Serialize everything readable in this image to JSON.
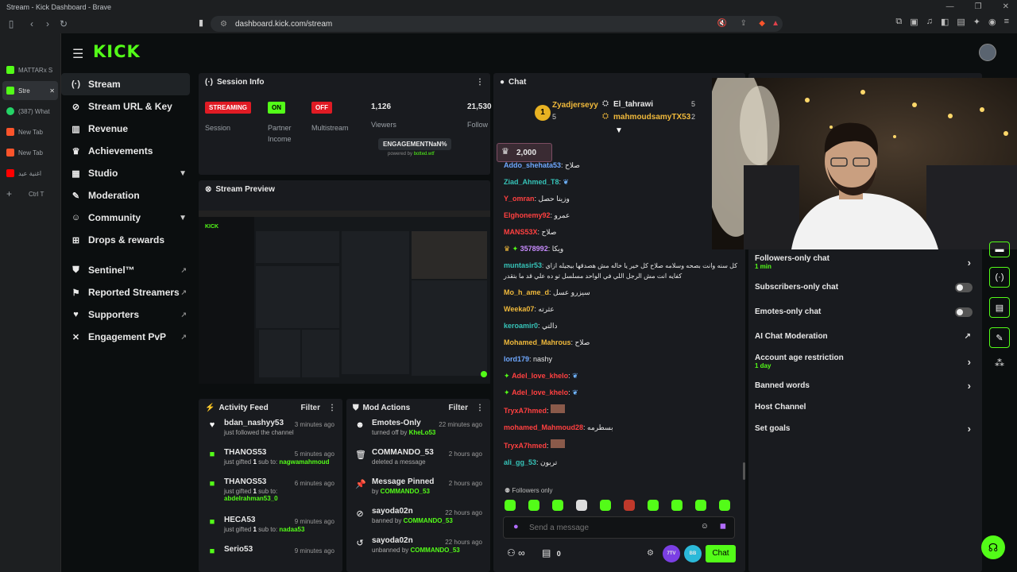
{
  "browser": {
    "window_title": "Stream - Kick Dashboard - Brave",
    "url": "dashboard.kick.com/stream",
    "tabs": [
      {
        "label": "MATTARx S",
        "color": "#53fc18"
      },
      {
        "label": "Stre",
        "color": "#53fc18",
        "active": true
      },
      {
        "label": "(387) What",
        "color": "#25d366"
      },
      {
        "label": "New Tab",
        "color": "#fb542b"
      },
      {
        "label": "New Tab",
        "color": "#fb542b"
      },
      {
        "label": "اغنية عيد ",
        "color": "#ff0000"
      }
    ],
    "new_tab_hint": "Ctrl T"
  },
  "brand": {
    "logo": "KICK",
    "accent": "#53fc18"
  },
  "sidebar": {
    "items": [
      {
        "label": "Stream",
        "icon": "broadcast-icon"
      },
      {
        "label": "Stream URL & Key",
        "icon": "link-icon"
      },
      {
        "label": "Revenue",
        "icon": "chart-icon"
      },
      {
        "label": "Achievements",
        "icon": "trophy-icon"
      },
      {
        "label": "Studio",
        "icon": "studio-icon"
      },
      {
        "label": "Moderation",
        "icon": "wrench-icon"
      },
      {
        "label": "Community",
        "icon": "people-icon"
      },
      {
        "label": "Drops & rewards",
        "icon": "drops-icon"
      },
      {
        "label": "Sentinel™",
        "icon": "shield-icon"
      },
      {
        "label": "Reported Streamers",
        "icon": "flag-icon"
      },
      {
        "label": "Supporters",
        "icon": "heart-icon"
      },
      {
        "label": "Engagement PvP",
        "icon": "swords-icon"
      }
    ]
  },
  "session": {
    "title": "Session Info",
    "streaming_tag": "STREAMING",
    "streaming_label": "Session",
    "partner_tag": "ON",
    "partner_label_1": "Partner",
    "partner_label_2": "Income",
    "multistream_tag": "OFF",
    "multistream_label": "Multistream",
    "viewers_value": "1,126",
    "viewers_label": "Viewers",
    "followers_value": "21,530",
    "followers_label": "Follow",
    "engagement": "ENGAGEMENTNaN%",
    "powered_by": "powered by",
    "powered_by_link": "botted.wtf"
  },
  "preview": {
    "title": "Stream Preview"
  },
  "activity": {
    "title": "Activity Feed",
    "filter": "Filter",
    "items": [
      {
        "user": "bdan_nashyy53",
        "detail": "just followed the channel",
        "ago": "3 minutes ago",
        "icon": "heart-icon"
      },
      {
        "user": "THANOS53",
        "detail_prefix": "just gifted ",
        "count": "1",
        "detail_mid": " sub to: ",
        "target": "nagwamahmoud",
        "ago": "5 minutes ago",
        "icon": "gift-icon"
      },
      {
        "user": "THANOS53",
        "detail_prefix": "just gifted ",
        "count": "1",
        "detail_mid": " sub to:",
        "target": "abdelrahman53_0",
        "ago": "6 minutes ago",
        "icon": "gift-icon"
      },
      {
        "user": "HECA53",
        "detail_prefix": "just gifted ",
        "count": "1",
        "detail_mid": " sub to: ",
        "target": "nadaa53",
        "ago": "9 minutes ago",
        "icon": "gift-icon"
      },
      {
        "user": "Serio53",
        "ago": "9 minutes ago",
        "icon": "gift-icon"
      }
    ]
  },
  "mod": {
    "title": "Mod Actions",
    "filter": "Filter",
    "items": [
      {
        "title": "Emotes-Only",
        "detail": "turned off by ",
        "by": "KheLo53",
        "ago": "22 minutes ago",
        "icon": "smile-icon"
      },
      {
        "title": "COMMANDO_53",
        "detail": "deleted a message",
        "by": "",
        "ago": "2 hours ago",
        "icon": "trash-icon"
      },
      {
        "title": "Message Pinned",
        "detail": "by ",
        "by": "COMMANDO_53",
        "ago": "2 hours ago",
        "icon": "pin-icon"
      },
      {
        "title": "sayoda02n",
        "detail": "banned by ",
        "by": "COMMANDO_53",
        "ago": "22 hours ago",
        "icon": "ban-icon"
      },
      {
        "title": "sayoda02n",
        "detail": "unbanned by ",
        "by": "COMMANDO_53",
        "ago": "22 hours ago",
        "icon": "undo-icon"
      }
    ]
  },
  "chat": {
    "title": "Chat",
    "top_gifters": [
      {
        "name": "Zyadjerseyy",
        "count": "5"
      },
      {
        "name": "El_tahrawi",
        "count": "5"
      },
      {
        "name": "mahmoudsamyTX53",
        "count": "2"
      }
    ],
    "rank_badge": "1",
    "pinned_value": "2,000",
    "messages": [
      {
        "user": "Addo_shehata53",
        "text": "صلاح",
        "cls": "u-b"
      },
      {
        "user": "Ziad_Ahmed_T8",
        "text": "",
        "cls": "u-g",
        "emote": true
      },
      {
        "user": "Y_omran",
        "text": "وزينا حصل",
        "cls": "u-r"
      },
      {
        "user": "Elghonemy92",
        "text": "عمرو",
        "cls": "u-r"
      },
      {
        "user": "MANS53X",
        "text": "صلاح",
        "cls": "u-r"
      },
      {
        "user": "3578992",
        "text": "ويكا",
        "cls": "u-p"
      },
      {
        "user": "muntasir53",
        "text": "كل سنه وانت بصحه وسلامه صلاح كل خير يا خاله مش هصدقها بيجيله ازاي",
        "cls": "u-g"
      },
      {
        "user": "",
        "text": "كفايه انت مش الرجل اللي في الواحد مسلسل تو ده علي قد ما بتقدر",
        "cls": "u-g"
      },
      {
        "user": "Mo_h_ame_d",
        "text": "سيزرو عسل",
        "cls": "u-o"
      },
      {
        "user": "Weeka07",
        "text": "عثرته",
        "cls": "u-o"
      },
      {
        "user": "keroamir0",
        "text": "دالتي",
        "cls": "u-g"
      },
      {
        "user": "Mohamed_Mahrous",
        "text": "صلاح",
        "cls": "u-o"
      },
      {
        "user": "lord179",
        "text": "nashy",
        "cls": "u-b"
      },
      {
        "user": "Adel_love_khelo",
        "text": "",
        "cls": "u-r",
        "emote": true
      },
      {
        "user": "Adel_love_khelo",
        "text": "",
        "cls": "u-r",
        "emote": true
      },
      {
        "user": "TryxA7hmed",
        "text": "",
        "cls": "u-r",
        "img": true
      },
      {
        "user": "mohamed_Mahmoud28",
        "text": "بسطرمه",
        "cls": "u-r"
      },
      {
        "user": "TryxA7hmed",
        "text": "",
        "cls": "u-r",
        "img": true
      },
      {
        "user": "ali_gg_53",
        "text": "تربون",
        "cls": "u-g"
      }
    ],
    "mode": "Followers only",
    "input_placeholder": "Send a message",
    "infinity": "∞",
    "count": "0",
    "badge_7tv": "7TV",
    "badge_bttv": "BB",
    "send_label": "Chat"
  },
  "settings": {
    "items": [
      {
        "label": "Followers-only chat",
        "sub": "1 min",
        "control": "chevron"
      },
      {
        "label": "Subscribers-only chat",
        "control": "toggle"
      },
      {
        "label": "Emotes-only chat",
        "control": "toggle"
      },
      {
        "label": "AI Chat Moderation",
        "control": "external"
      },
      {
        "label": "Account age restriction",
        "sub": "1 day",
        "control": "chevron"
      },
      {
        "label": "Banned words",
        "control": "chevron"
      },
      {
        "label": "Host Channel",
        "control": "none"
      },
      {
        "label": "Set goals",
        "control": "chevron"
      }
    ]
  }
}
